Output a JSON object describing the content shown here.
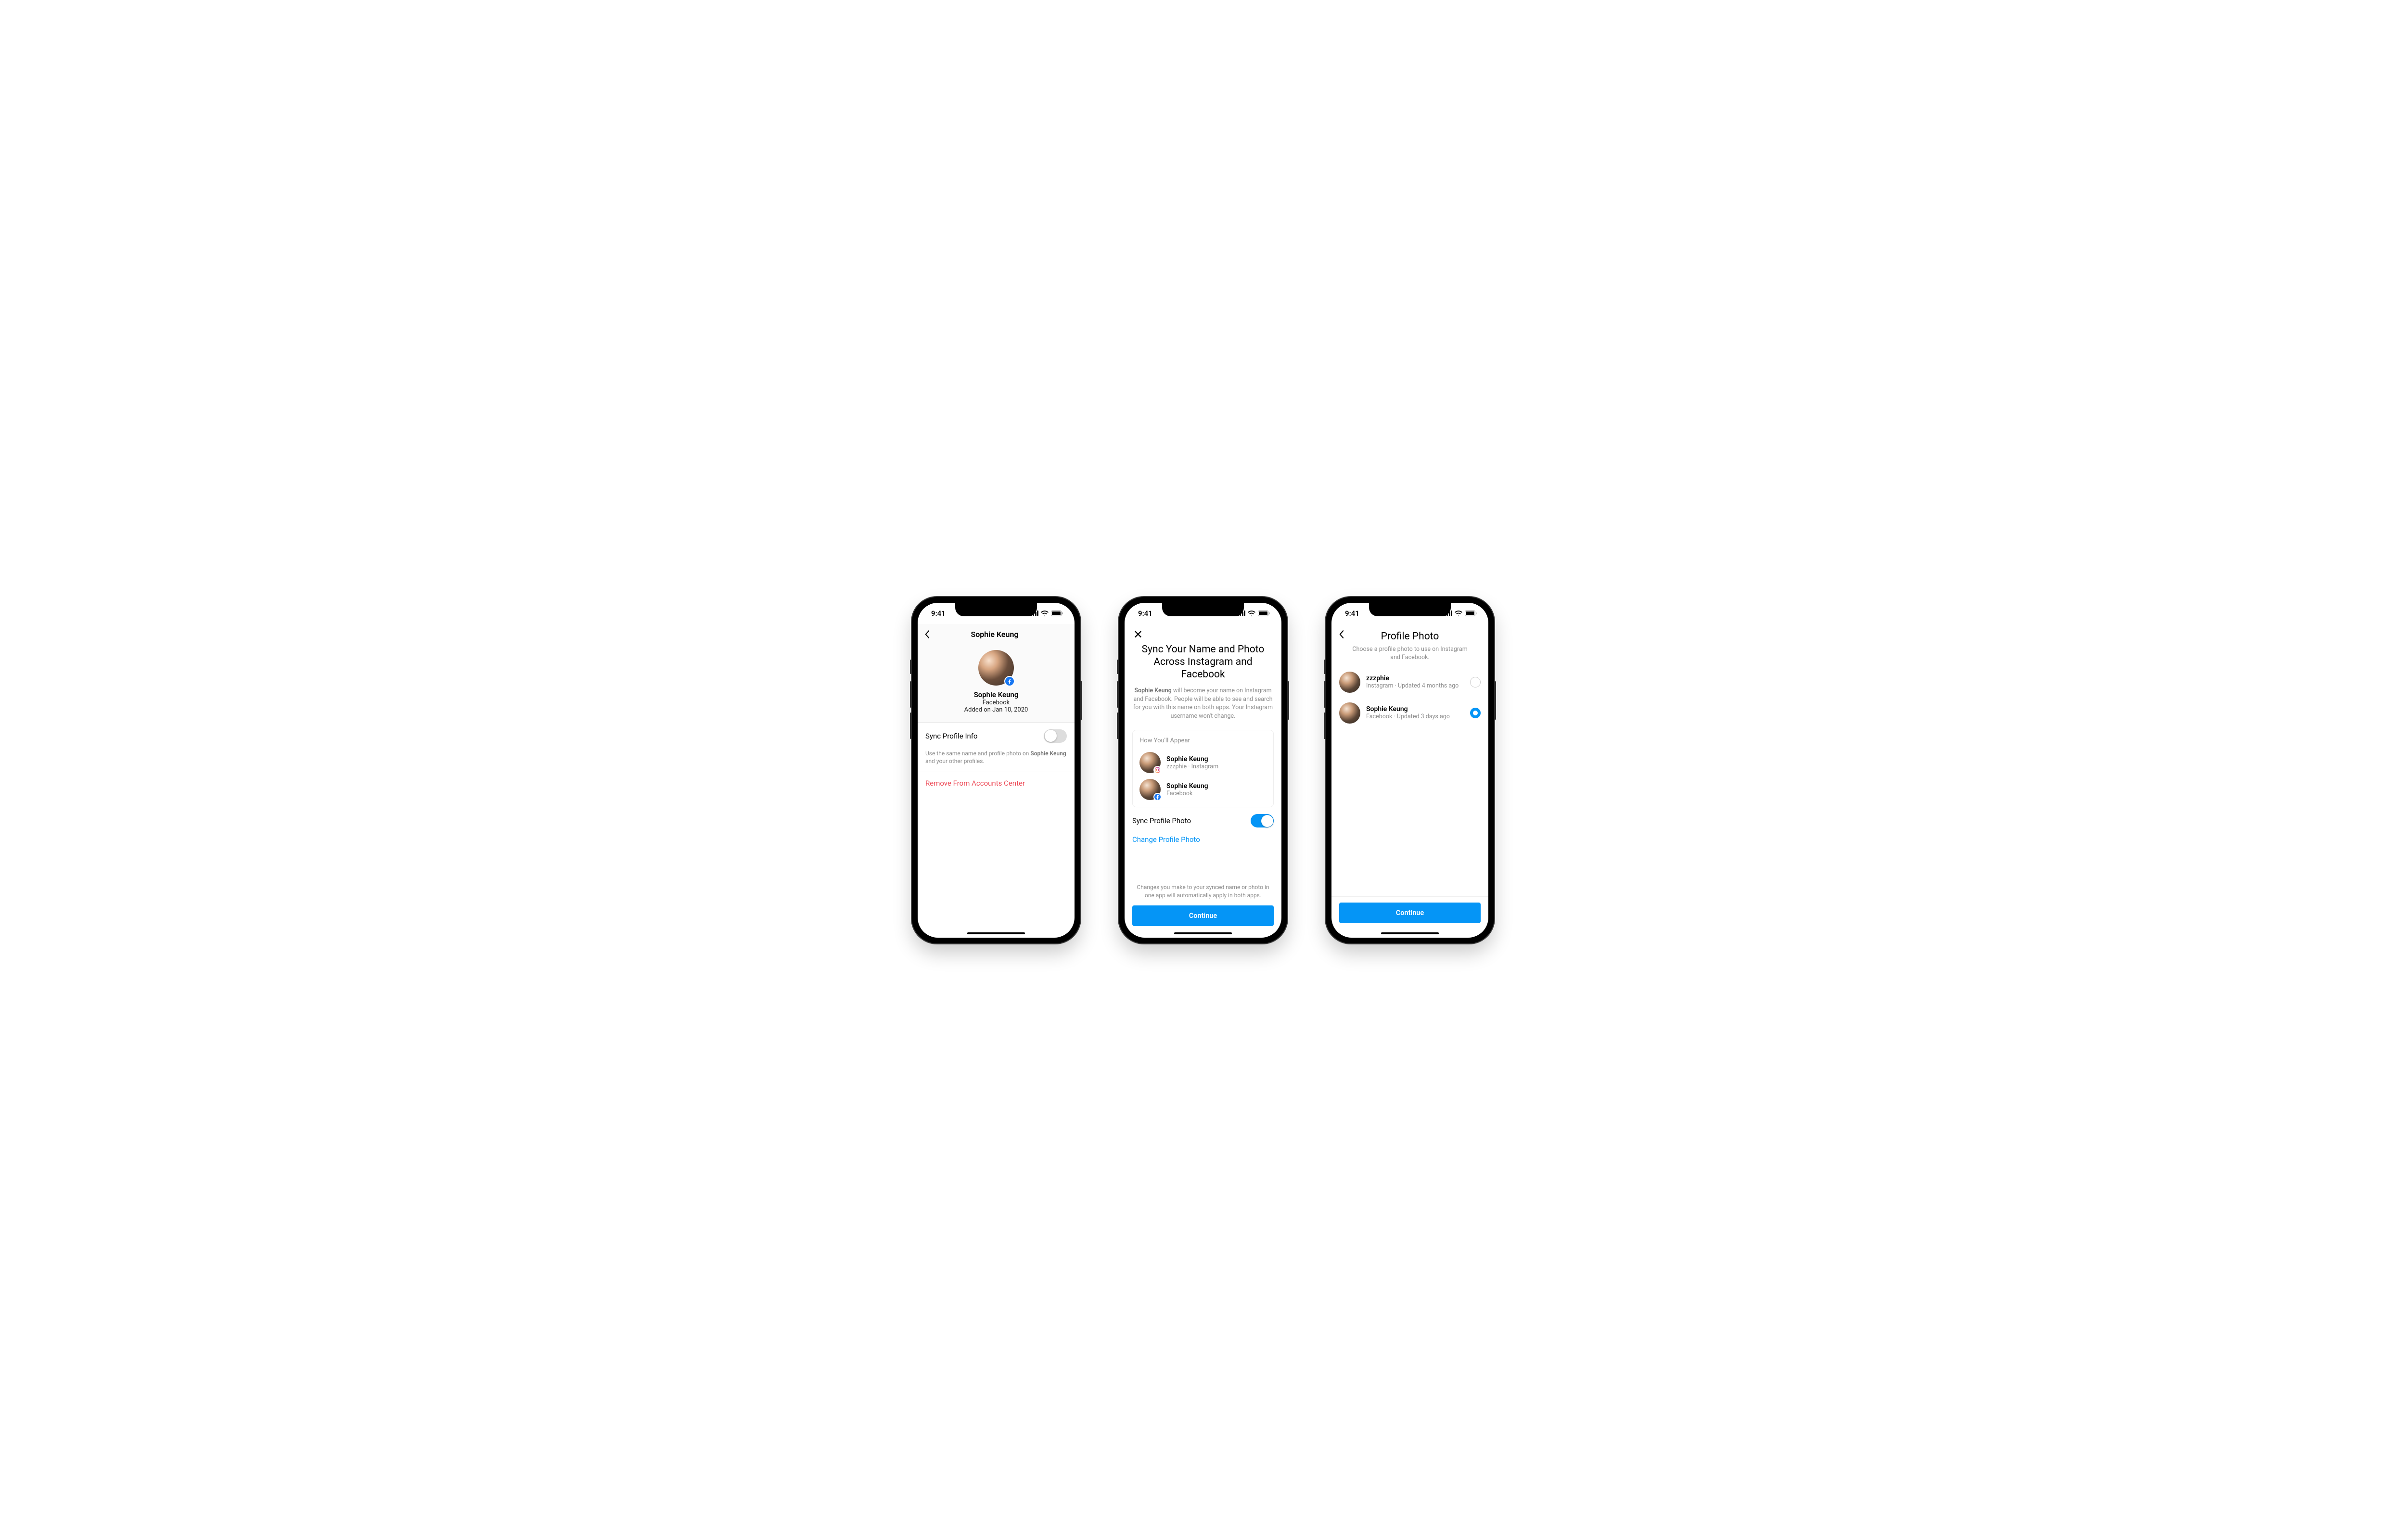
{
  "status_time": "9:41",
  "screen1": {
    "header_title": "Sophie Keung",
    "profile_name": "Sophie Keung",
    "profile_app": "Facebook",
    "profile_added": "Added on Jan 10, 2020",
    "sync_label": "Sync Profile Info",
    "sync_help_pre": "Use the same name and profile photo on ",
    "sync_help_bold": "Sophie Keung",
    "sync_help_post": " and your other profiles.",
    "remove_label": "Remove From Accounts Center"
  },
  "screen2": {
    "title": "Sync Your Name and Photo Across Instagram and Facebook",
    "desc_bold": "Sophie Keung",
    "desc_rest": " will become your name on Instagram and Facebook. People will be able to see and search for you with this name on both apps. Your Instagram username won't change.",
    "card_label": "How You'll Appear",
    "rows": [
      {
        "name": "Sophie Keung",
        "sub": "zzzphie · Instagram",
        "badge": "ig"
      },
      {
        "name": "Sophie Keung",
        "sub": "Facebook",
        "badge": "fb"
      }
    ],
    "sync_photo_label": "Sync Profile Photo",
    "change_photo_label": "Change Profile Photo",
    "footnote": "Changes you make to your synced name or photo in one app will automatically apply in both apps.",
    "continue_label": "Continue"
  },
  "screen3": {
    "title": "Profile Photo",
    "subtitle": "Choose a profile photo to use on Instagram and Facebook.",
    "options": [
      {
        "name": "zzzphie",
        "sub": "Instagram · Updated 4 months ago",
        "selected": false
      },
      {
        "name": "Sophie Keung",
        "sub": "Facebook · Updated 3 days ago",
        "selected": true
      }
    ],
    "continue_label": "Continue"
  }
}
